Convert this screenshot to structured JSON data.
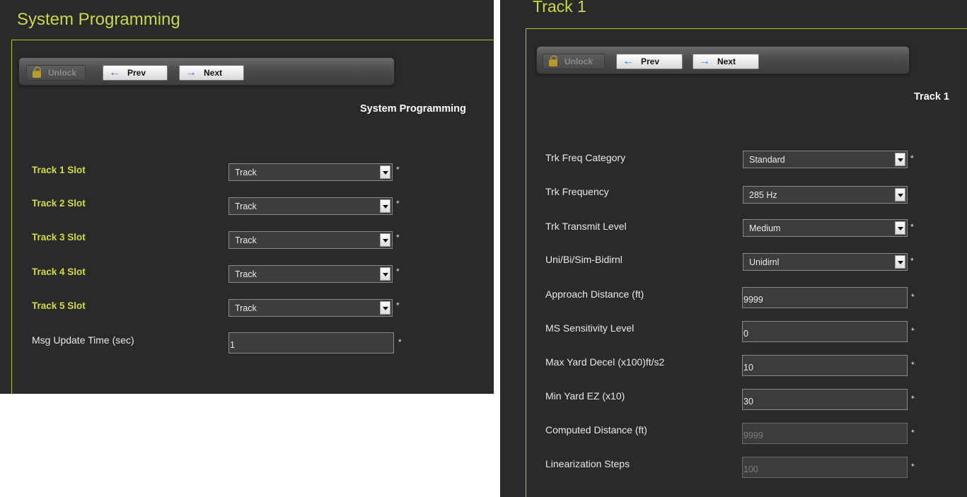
{
  "left": {
    "window_title": "System Programming",
    "toolbar": {
      "unlock": "Unlock",
      "prev": "Prev",
      "next": "Next"
    },
    "section_title": "System Programming",
    "rows": [
      {
        "label": "Track 1 Slot",
        "value": "Track"
      },
      {
        "label": "Track 2 Slot",
        "value": "Track"
      },
      {
        "label": "Track 3 Slot",
        "value": "Track"
      },
      {
        "label": "Track 4 Slot",
        "value": "Track"
      },
      {
        "label": "Track 5 Slot",
        "value": "Track"
      },
      {
        "label": "Msg Update Time (sec)",
        "value": "1"
      }
    ]
  },
  "right": {
    "window_title": "Track 1",
    "toolbar": {
      "unlock": "Unlock",
      "prev": "Prev",
      "next": "Next"
    },
    "section_title": "Track 1",
    "rows": [
      {
        "label": "Trk Freq Category",
        "value": "Standard"
      },
      {
        "label": "Trk Frequency",
        "value": "285 Hz"
      },
      {
        "label": "Trk Transmit Level",
        "value": "Medium"
      },
      {
        "label": "Uni/Bi/Sim-Bidirnl",
        "value": "Unidirnl"
      },
      {
        "label": "Approach Distance (ft)",
        "value": "9999"
      },
      {
        "label": "MS Sensitivity Level",
        "value": "0"
      },
      {
        "label": "Max Yard Decel (x100)ft/s2",
        "value": "10"
      },
      {
        "label": "Min Yard EZ (x10)",
        "value": "30"
      },
      {
        "label": "Computed Distance (ft)",
        "value": "9999"
      },
      {
        "label": "Linearization Steps",
        "value": "100"
      }
    ]
  },
  "required_marker": "*"
}
